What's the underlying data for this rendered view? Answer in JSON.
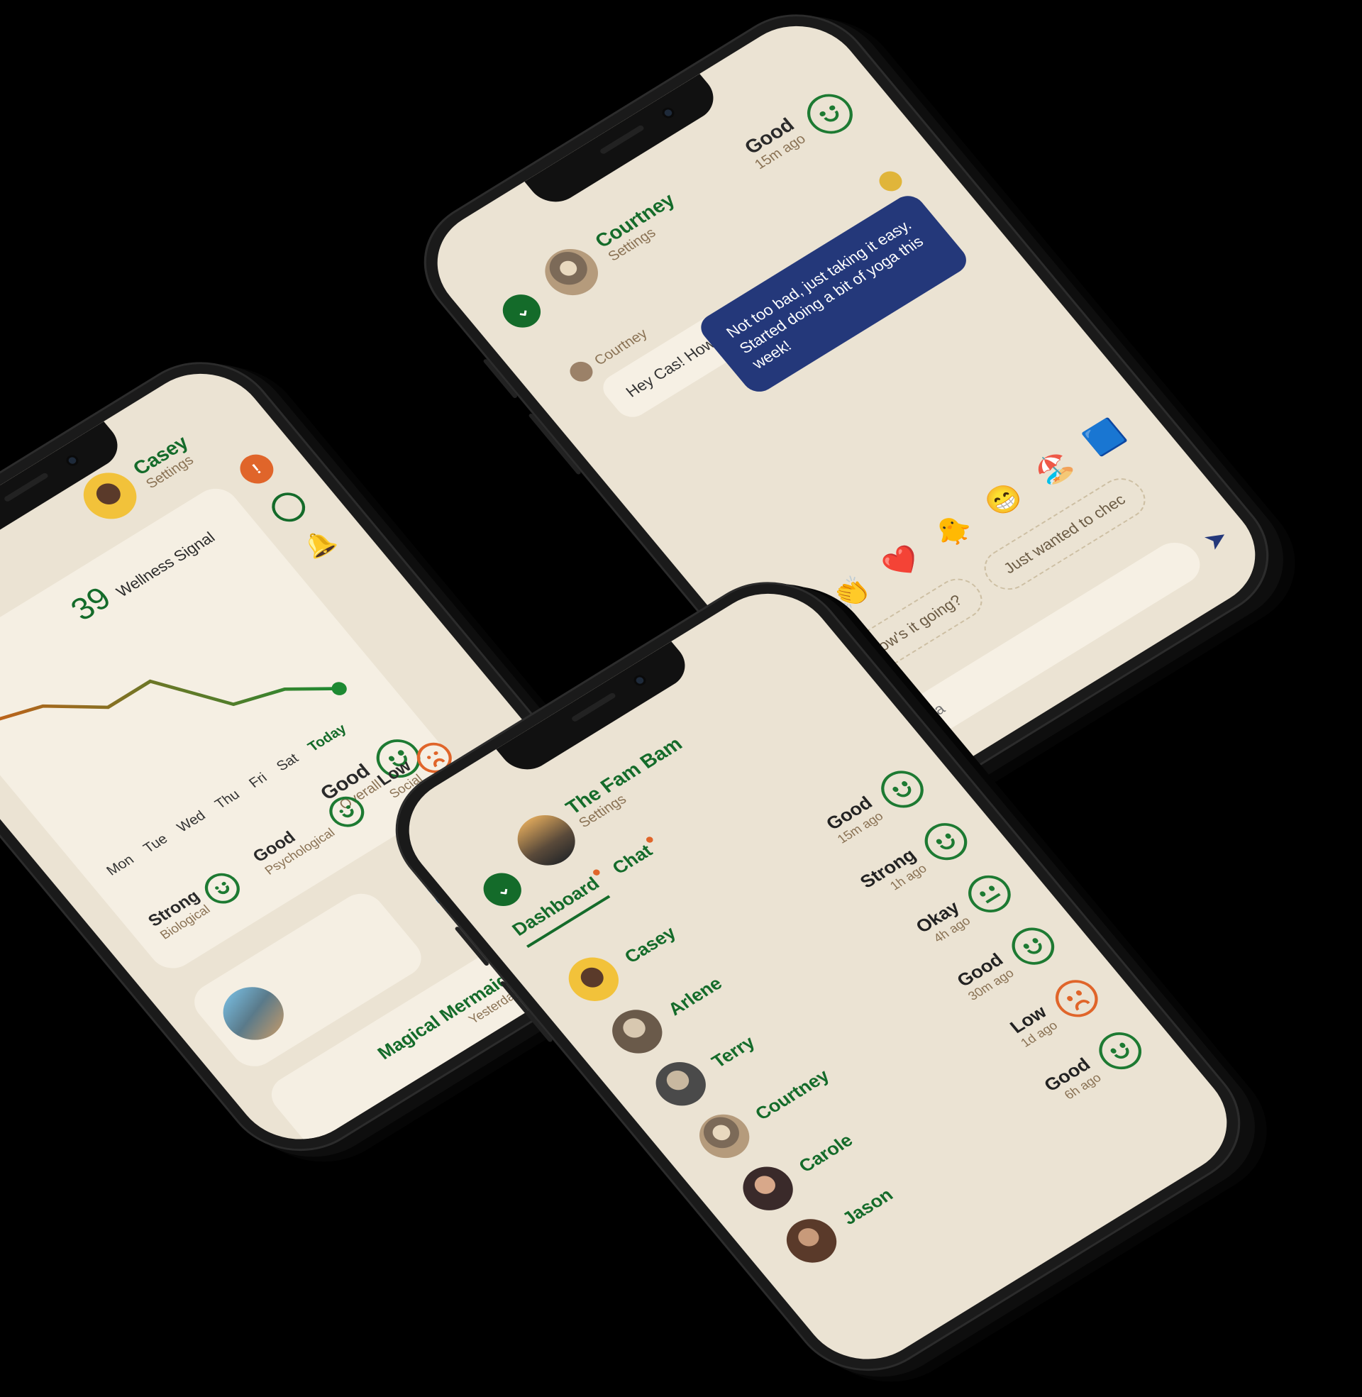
{
  "chat": {
    "contact_name": "Courtney",
    "contact_sub": "Settings",
    "mood": "Good",
    "mood_time": "15m ago",
    "incoming_sender": "Courtney",
    "incoming_text": "Hey Cas! How've you been?",
    "outgoing_text": "Not too bad, just taking it easy. Started doing a bit of yoga this week!",
    "emojis": [
      "🤙",
      "👏",
      "❤️",
      "🐥",
      "😁",
      "🏖️",
      "🟦"
    ],
    "quick_replies": [
      "Hey, how's it going?",
      "Just wanted to chec"
    ],
    "input_placeholder": "Aa"
  },
  "dashboard": {
    "user_name": "Casey",
    "user_sub": "Settings",
    "wellness_label": "Wellness Signal",
    "wellness_value": "39",
    "days": [
      "Mon",
      "Tue",
      "Wed",
      "Thu",
      "Fri",
      "Sat",
      "Today"
    ],
    "overall_value": "Good",
    "overall_label": "Overall",
    "factors": [
      {
        "value": "Strong",
        "label": "Biological",
        "mood": "happy"
      },
      {
        "value": "Good",
        "label": "Psychological",
        "mood": "happy"
      },
      {
        "value": "Low",
        "label": "Social",
        "mood": "sad"
      }
    ],
    "group_name": "Magical Mermaid",
    "group_time": "Yesterday",
    "alert_badge": "!",
    "colors": {
      "line_start": "#c0621a",
      "line_end": "#1d8a32"
    }
  },
  "group": {
    "title": "The Fam Bam",
    "sub": "Settings",
    "tabs": [
      "Dashboard",
      "Chat"
    ],
    "members": [
      {
        "name": "Casey",
        "mood": "Good",
        "time": "15m ago",
        "face": "happy"
      },
      {
        "name": "Arlene",
        "mood": "Strong",
        "time": "1h ago",
        "face": "happy"
      },
      {
        "name": "Terry",
        "mood": "Okay",
        "time": "4h ago",
        "face": "neutral"
      },
      {
        "name": "Courtney",
        "mood": "Good",
        "time": "30m ago",
        "face": "happy"
      },
      {
        "name": "Carole",
        "mood": "Low",
        "time": "1d ago",
        "face": "sad"
      },
      {
        "name": "Jason",
        "mood": "Good",
        "time": "6h ago",
        "face": "happy"
      }
    ]
  }
}
